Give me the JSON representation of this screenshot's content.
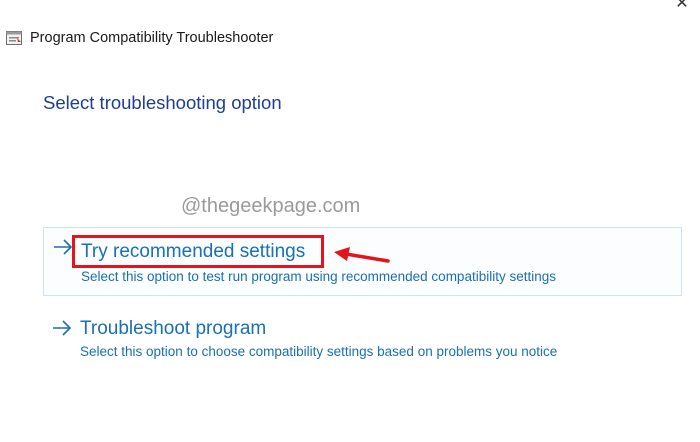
{
  "window": {
    "title": "Program Compatibility Troubleshooter",
    "close_glyph": "✕"
  },
  "heading": "Select troubleshooting option",
  "watermark": "@thegeekpage.com",
  "options": [
    {
      "title": "Try recommended settings",
      "description": "Select this option to test run program using recommended compatibility settings",
      "icon": "arrow-right-icon"
    },
    {
      "title": "Troubleshoot program",
      "description": "Select this option to choose compatibility settings based on problems you notice",
      "icon": "arrow-right-icon"
    }
  ],
  "colors": {
    "heading": "#1e3f8f",
    "link": "#1a6fb5",
    "highlight": "#e3141b",
    "selected_border": "#cfe3f3"
  }
}
